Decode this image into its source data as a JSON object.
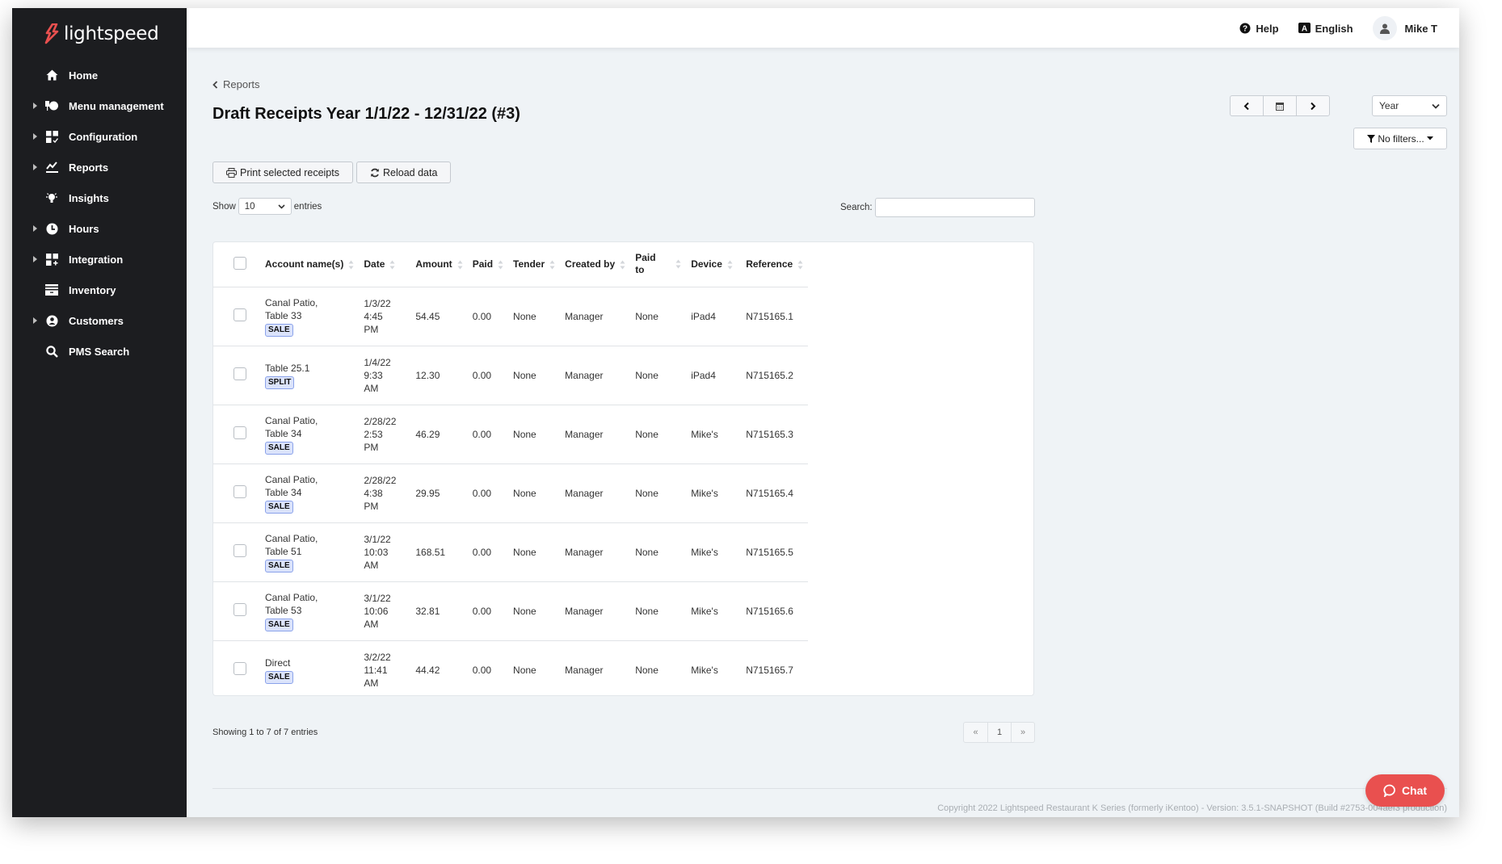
{
  "app": {
    "brand": "lightspeed",
    "brand_color": "#e9504f"
  },
  "sidebar": {
    "items": [
      {
        "label": "Home",
        "icon": "home-icon",
        "expandable": false
      },
      {
        "label": "Menu management",
        "icon": "menu-management-icon",
        "expandable": true
      },
      {
        "label": "Configuration",
        "icon": "configuration-icon",
        "expandable": true
      },
      {
        "label": "Reports",
        "icon": "reports-chart-icon",
        "expandable": true
      },
      {
        "label": "Insights",
        "icon": "lightbulb-icon",
        "expandable": false
      },
      {
        "label": "Hours",
        "icon": "clock-icon",
        "expandable": true
      },
      {
        "label": "Integration",
        "icon": "integration-icon",
        "expandable": true
      },
      {
        "label": "Inventory",
        "icon": "inventory-box-icon",
        "expandable": false
      },
      {
        "label": "Customers",
        "icon": "customer-icon",
        "expandable": true
      },
      {
        "label": "PMS Search",
        "icon": "search-icon",
        "expandable": false
      }
    ]
  },
  "topbar": {
    "help": "Help",
    "language": "English",
    "user": "Mike T"
  },
  "breadcrumb": {
    "label": "Reports"
  },
  "page": {
    "title": "Draft Receipts Year 1/1/22 - 12/31/22 (#3)"
  },
  "period": {
    "selected": "Year"
  },
  "filters": {
    "label": "No filters..."
  },
  "actions": {
    "print": "Print selected receipts",
    "reload": "Reload data"
  },
  "length": {
    "show": "Show",
    "value": "10",
    "entries": "entries"
  },
  "search": {
    "label": "Search:",
    "value": "",
    "placeholder": ""
  },
  "table": {
    "columns": [
      "Account name(s)",
      "Date",
      "Amount",
      "Paid",
      "Tender",
      "Created by",
      "Paid to",
      "Device",
      "Reference"
    ],
    "rows": [
      {
        "account_line1": "Canal Patio,",
        "account_line2": "Table 33",
        "badge": "SALE",
        "date": "1/3/22",
        "time": "4:45",
        "ampm": "PM",
        "amount": "54.45",
        "paid": "0.00",
        "tender": "None",
        "created_by": "Manager",
        "paid_to": "None",
        "device": "iPad4",
        "reference": "N715165.1"
      },
      {
        "account_line1": "Table 25.1",
        "account_line2": "",
        "badge": "SPLIT",
        "date": "1/4/22",
        "time": "9:33",
        "ampm": "AM",
        "amount": "12.30",
        "paid": "0.00",
        "tender": "None",
        "created_by": "Manager",
        "paid_to": "None",
        "device": "iPad4",
        "reference": "N715165.2"
      },
      {
        "account_line1": "Canal Patio,",
        "account_line2": "Table 34",
        "badge": "SALE",
        "date": "2/28/22",
        "time": "2:53",
        "ampm": "PM",
        "amount": "46.29",
        "paid": "0.00",
        "tender": "None",
        "created_by": "Manager",
        "paid_to": "None",
        "device": "Mike's",
        "reference": "N715165.3"
      },
      {
        "account_line1": "Canal Patio,",
        "account_line2": "Table 34",
        "badge": "SALE",
        "date": "2/28/22",
        "time": "4:38",
        "ampm": "PM",
        "amount": "29.95",
        "paid": "0.00",
        "tender": "None",
        "created_by": "Manager",
        "paid_to": "None",
        "device": "Mike's",
        "reference": "N715165.4"
      },
      {
        "account_line1": "Canal Patio,",
        "account_line2": "Table 51",
        "badge": "SALE",
        "date": "3/1/22",
        "time": "10:03",
        "ampm": "AM",
        "amount": "168.51",
        "paid": "0.00",
        "tender": "None",
        "created_by": "Manager",
        "paid_to": "None",
        "device": "Mike's",
        "reference": "N715165.5"
      },
      {
        "account_line1": "Canal Patio,",
        "account_line2": "Table 53",
        "badge": "SALE",
        "date": "3/1/22",
        "time": "10:06",
        "ampm": "AM",
        "amount": "32.81",
        "paid": "0.00",
        "tender": "None",
        "created_by": "Manager",
        "paid_to": "None",
        "device": "Mike's",
        "reference": "N715165.6"
      },
      {
        "account_line1": "Direct",
        "account_line2": "",
        "badge": "SALE",
        "date": "3/2/22",
        "time": "11:41",
        "ampm": "AM",
        "amount": "44.42",
        "paid": "0.00",
        "tender": "None",
        "created_by": "Manager",
        "paid_to": "None",
        "device": "Mike's",
        "reference": "N715165.7"
      }
    ]
  },
  "footer": {
    "info": "Showing 1 to 7 of 7 entries",
    "pagination": {
      "prev": "«",
      "current": "1",
      "next": "»"
    },
    "copyright": "Copyright 2022 Lightspeed Restaurant K Series (formerly iKentoo) - Version: 3.5.1-SNAPSHOT (Build #2753-004aef3 production)",
    "chat": "Chat"
  }
}
